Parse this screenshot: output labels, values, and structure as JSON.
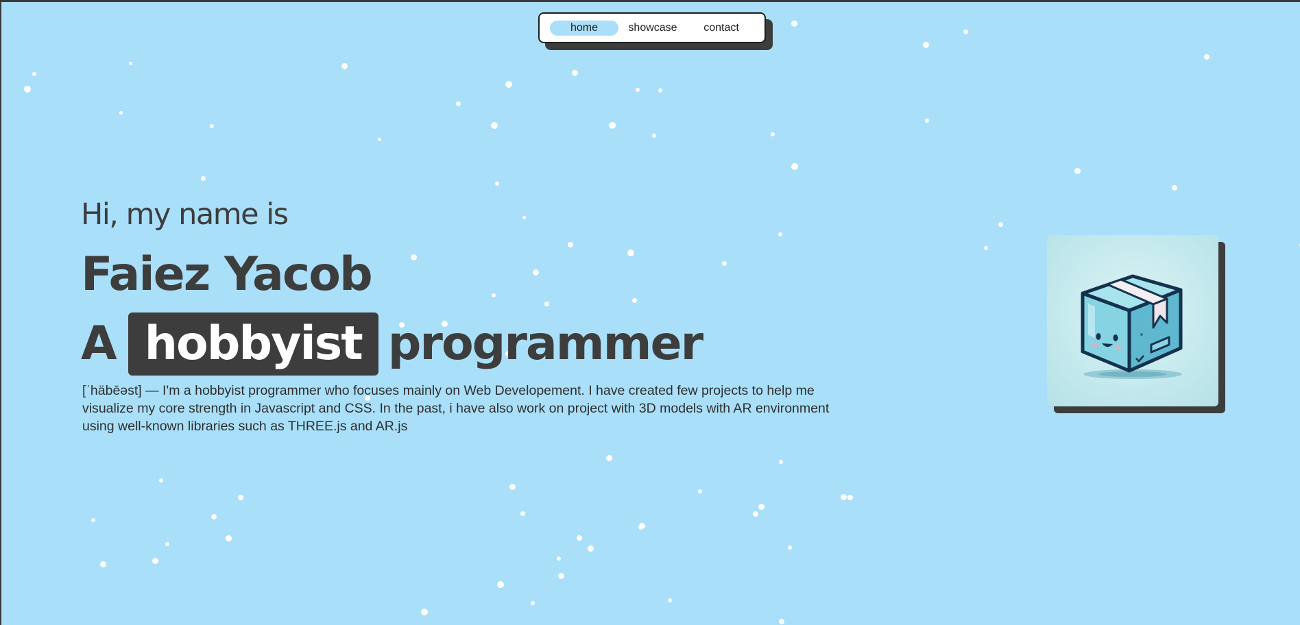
{
  "nav": {
    "items": [
      {
        "label": "home",
        "active": true
      },
      {
        "label": "showcase",
        "active": false
      },
      {
        "label": "contact",
        "active": false
      }
    ]
  },
  "hero": {
    "greeting": "Hi, my name is",
    "name": "Faiez Yacob",
    "tagline_prefix": "A",
    "tagline_highlight": "hobbyist",
    "tagline_suffix": "programmer",
    "description": "[ˈhäbēəst] — I'm a hobbyist programmer who focuses mainly on Web Developement. I have created few projects to help me visualize my core strength in Javascript and CSS. In the past, i have also work on project with 3D models with AR environment using well-known libraries such as THREE.js and AR.js"
  },
  "illustration": {
    "icon": "cute-box-icon"
  },
  "colors": {
    "background": "#a9dff8",
    "text": "#3d3d3d",
    "highlight_bg": "#3d3d3d",
    "highlight_text": "#ffffff",
    "nav_active": "#a9dff8",
    "snow": "#ffffff"
  }
}
